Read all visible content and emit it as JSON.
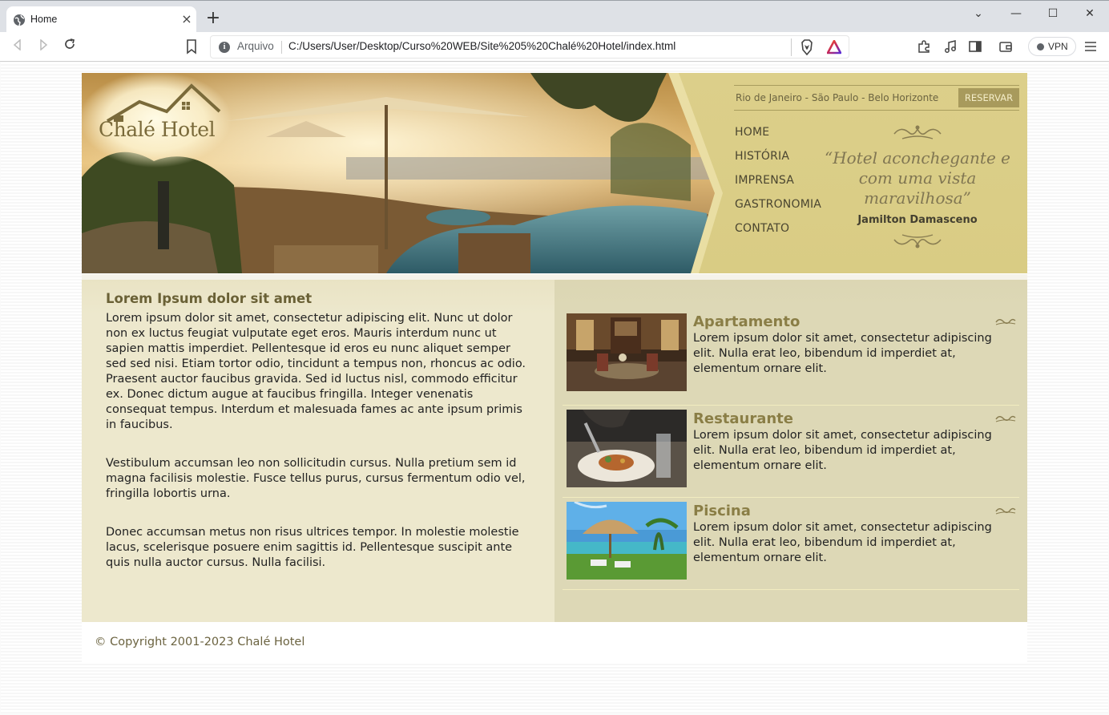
{
  "browser": {
    "tab_title": "Home",
    "tab_close": "×",
    "new_tab": "+",
    "origin_label": "Arquivo",
    "url": "C:/Users/User/Desktop/Curso%20WEB/Site%205%20Chalé%20Hotel/index.html",
    "vpn_label": "VPN",
    "window_controls": [
      "⌄",
      "—",
      "☐",
      "✕"
    ]
  },
  "header": {
    "logo_text": "Chalé Hotel",
    "cities": "Rio de Janeiro - São Paulo - Belo Horizonte",
    "reserve_label": "RESERVAR",
    "nav": [
      "HOME",
      "HISTÓRIA",
      "IMPRENSA",
      "GASTRONOMIA",
      "CONTATO"
    ],
    "quote": "“Hotel aconchegante e com uma vista maravilhosa”",
    "quote_author": "Jamilton Damasceno"
  },
  "main": {
    "heading": "Lorem Ipsum dolor sit amet",
    "paragraphs": [
      "Lorem ipsum dolor sit amet, consectetur adipiscing elit. Nunc ut dolor non ex luctus feugiat vulputate eget eros. Mauris interdum nunc ut sapien mattis imperdiet. Pellentesque id eros eu nunc aliquet semper sed sed nisi. Etiam tortor odio, tincidunt a tempus non, rhoncus ac odio. Praesent auctor faucibus gravida. Sed id luctus nisl, commodo efficitur ex. Donec dictum augue at faucibus fringilla. Integer venenatis consequat tempus. Interdum et malesuada fames ac ante ipsum primis in faucibus.",
      "Vestibulum accumsan leo non sollicitudin cursus. Nulla pretium sem id magna facilisis molestie. Fusce tellus purus, cursus fermentum odio vel, fringilla lobortis urna.",
      "Donec accumsan metus non risus ultrices tempor. In molestie molestie lacus, scelerisque posuere enim sagittis id. Pellentesque suscipit ante quis nulla auctor cursus. Nulla facilisi."
    ]
  },
  "features": [
    {
      "title": "Apartamento",
      "desc": "Lorem ipsum dolor sit amet, consectetur adipiscing elit. Nulla erat leo, bibendum id imperdiet at, elementum ornare elit."
    },
    {
      "title": "Restaurante",
      "desc": "Lorem ipsum dolor sit amet, consectetur adipiscing elit. Nulla erat leo, bibendum id imperdiet at, elementum ornare elit."
    },
    {
      "title": "Piscina",
      "desc": "Lorem ipsum dolor sit amet, consectetur adipiscing elit. Nulla erat leo, bibendum id imperdiet at, elementum ornare elit."
    }
  ],
  "footer": {
    "copyright": "© Copyright 2001-2023 Chalé Hotel"
  },
  "colors": {
    "header_gold": "#dccf8a",
    "reserve_button": "#a89a5c",
    "accent_text": "#6a6136"
  }
}
